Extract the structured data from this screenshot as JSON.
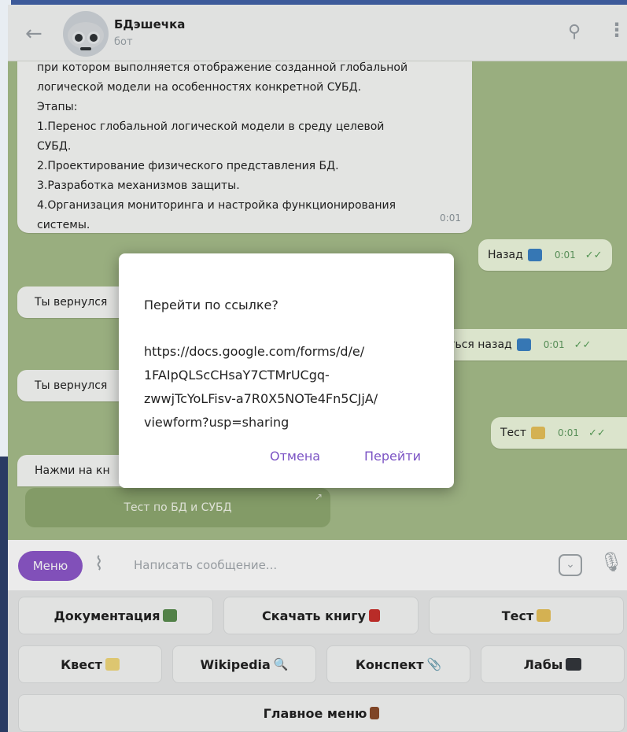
{
  "header": {
    "chat_title": "БДэшечка",
    "chat_subtitle": "бот"
  },
  "messages": {
    "main_lines": [
      "при котором выполняется отображение созданной глобальной",
      "логической модели на особенностях конкретной СУБД.",
      "Этапы:",
      "1.Перенос глобальной логической модели в среду целевой",
      "СУБД.",
      "2.Проектирование физического представления БД.",
      "3.Разработка механизмов защиты.",
      "4.Организация мониторинга и настройка функционирования",
      "системы."
    ],
    "main_time": "0:01",
    "out_back_1": "Назад",
    "out_back_1_time": "0:01",
    "in_returned_1": "Ты вернулся",
    "out_back_2": "уться назад",
    "out_back_2_time": "0:01",
    "in_returned_2": "Ты вернулся",
    "out_test": "Тест",
    "out_test_time": "0:01",
    "in_press": "Нажми на кн",
    "inline_button": "Тест по БД и СУБД"
  },
  "composer": {
    "menu_label": "Меню",
    "placeholder": "Написать сообщение..."
  },
  "keyboard": {
    "row1": [
      "Документация",
      "Скачать книгу",
      "Тест"
    ],
    "row2": [
      "Квест",
      "Wikipedia",
      "Конспект",
      "Лабы"
    ],
    "row3": [
      "Главное меню"
    ]
  },
  "dialog": {
    "title": "Перейти по ссылке?",
    "link_lines": [
      "https://docs.google.com/forms/d/e/",
      "1FAIpQLScCHsaY7CTMrUCgq-",
      "zwwjTcYoLFisv-a7R0X5NOTe4Fn5CJjA/",
      "viewform?usp=sharing"
    ],
    "cancel_label": "Отмена",
    "go_label": "Перейти"
  },
  "colors": {
    "accent": "#8c57c9",
    "dialog_button": "#7b53c4",
    "chat_background": "#a7bd8a",
    "inline_button": "#8fa970"
  },
  "icons": [
    "back-arrow-icon",
    "search-icon",
    "more-icon",
    "paperclip-icon",
    "keyboard-toggle-icon",
    "microphone-icon",
    "double-check-icon",
    "external-link-icon"
  ]
}
